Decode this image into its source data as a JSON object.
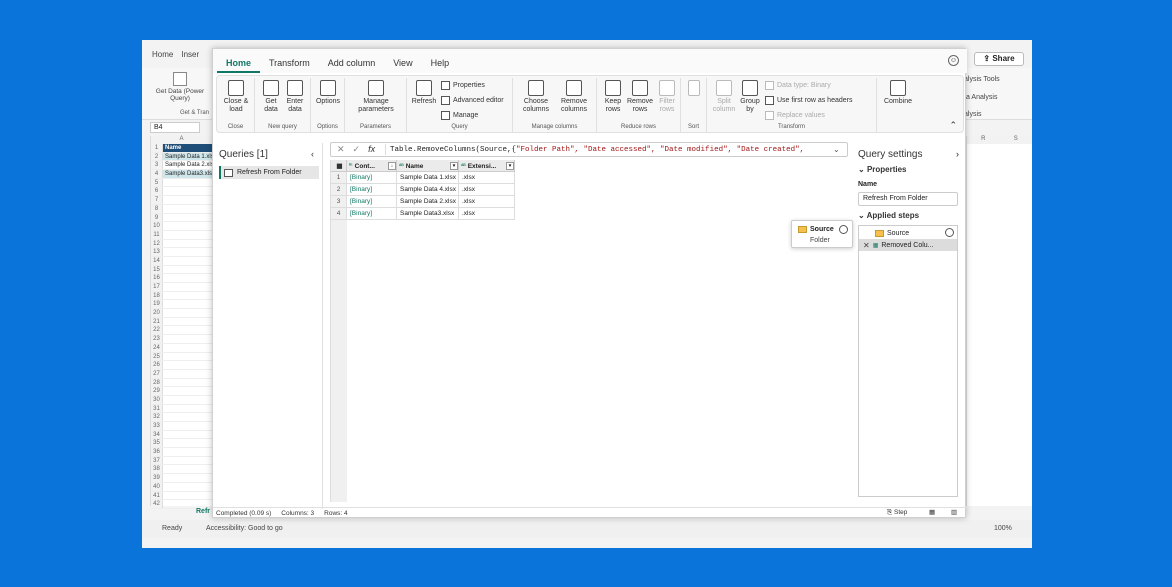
{
  "excel": {
    "tabs": [
      "Home",
      "Inser"
    ],
    "ribbon_label": "Get Data (Power Query)",
    "ribbon_group": "Get & Tran",
    "share_label": "Share",
    "namebox": "B4",
    "col_a": "A",
    "right_cols": [
      "R",
      "S"
    ],
    "right_texts": [
      "alysis Tools",
      "ta Analysis",
      "alysis"
    ],
    "rows": [
      {
        "n": "1",
        "v": "Name",
        "style": "hdr"
      },
      {
        "n": "2",
        "v": "Sample Data 1.xls",
        "style": "sel"
      },
      {
        "n": "3",
        "v": "Sample Data 2.xls",
        "style": ""
      },
      {
        "n": "4",
        "v": "Sample Data3.xls",
        "style": "sel"
      }
    ],
    "sheet_tab": "Refr",
    "status_ready": "Ready",
    "status_access": "Accessibility: Good to go",
    "zoom": "100%"
  },
  "pq": {
    "menu": [
      "Home",
      "Transform",
      "Add column",
      "View",
      "Help"
    ],
    "ribbon": {
      "close_load": "Close & load",
      "close_group": "Close",
      "get_data": "Get data",
      "enter_data": "Enter data",
      "new_query_group": "New query",
      "options": "Options",
      "options_group": "Options",
      "manage_params": "Manage parameters",
      "params_group": "Parameters",
      "refresh": "Refresh",
      "properties": "Properties",
      "adv_editor": "Advanced editor",
      "manage": "Manage",
      "query_group": "Query",
      "choose_cols": "Choose columns",
      "remove_cols": "Remove columns",
      "manage_cols_group": "Manage columns",
      "keep_rows": "Keep rows",
      "remove_rows": "Remove rows",
      "filter_rows": "Filter rows",
      "reduce_group": "Reduce rows",
      "sort_group": "Sort",
      "split_col": "Split column",
      "group_by": "Group by",
      "data_type": "Data type: Binary",
      "first_row": "Use first row as headers",
      "replace_values": "Replace values",
      "transform_group": "Transform",
      "combine": "Combine"
    },
    "queries_title": "Queries [1]",
    "query_item": "Refresh From Folder",
    "formula": {
      "prefix": "Table.RemoveColumns(Source,{",
      "strings": "\"Folder Path\", \"Date accessed\", \"Date modified\", \"Date created\","
    },
    "columns": [
      "Cont...",
      "Name",
      "Extensi..."
    ],
    "rows": [
      {
        "n": "1",
        "content": "[Binary]",
        "name": "Sample Data 1.xlsx",
        "ext": ".xlsx"
      },
      {
        "n": "2",
        "content": "[Binary]",
        "name": "Sample Data 4.xlsx",
        "ext": ".xlsx"
      },
      {
        "n": "3",
        "content": "[Binary]",
        "name": "Sample Data 2.xlsx",
        "ext": ".xlsx"
      },
      {
        "n": "4",
        "content": "[Binary]",
        "name": "Sample Data3.xlsx",
        "ext": ".xlsx"
      }
    ],
    "tooltip": {
      "title": "Source",
      "sub": "Folder"
    },
    "settings": {
      "title": "Query settings",
      "properties": "Properties",
      "name_label": "Name",
      "name_value": "Refresh From Folder",
      "applied": "Applied steps",
      "steps": [
        "Source",
        "Removed Colu..."
      ]
    },
    "status": {
      "completed": "Completed (0.09 s)",
      "columns": "Columns: 3",
      "rows": "Rows: 4",
      "step": "Step"
    }
  }
}
